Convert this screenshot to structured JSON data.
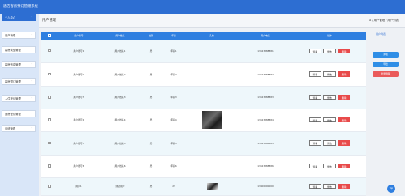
{
  "app": {
    "title": "酒店客房预订管理系统"
  },
  "sidebar": {
    "items": [
      {
        "label": "个人中心",
        "active": true
      },
      {
        "label": "用户管理",
        "active": false
      },
      {
        "label": "客房类型管理",
        "active": false
      },
      {
        "label": "客房信息管理",
        "active": false
      },
      {
        "label": "客房预订管理",
        "active": false
      },
      {
        "label": "入住登记管理",
        "active": false
      },
      {
        "label": "退房登记管理",
        "active": false
      },
      {
        "label": "系统管理",
        "active": false
      }
    ]
  },
  "header": {
    "page_title": "用户管理",
    "breadcrumb": "⌂ / 用户管理 / 用户列表"
  },
  "table": {
    "columns": [
      "",
      "用户账号",
      "用户姓名",
      "性别",
      "年龄",
      "头像",
      "用户电话",
      "操作"
    ],
    "rows": [
      {
        "account": "用户账号1",
        "name": "用户姓名1",
        "gender": "男",
        "age": "年龄1",
        "avatar": "",
        "phone": "13823888881"
      },
      {
        "account": "用户账号2",
        "name": "用户姓名2",
        "gender": "男",
        "age": "年龄2",
        "avatar": "",
        "phone": "13823888882"
      },
      {
        "account": "用户账号3",
        "name": "用户姓名3",
        "gender": "男",
        "age": "年龄3",
        "avatar": "",
        "phone": "13823888883"
      },
      {
        "account": "用户账号4",
        "name": "用户姓名4",
        "gender": "男",
        "age": "年龄4",
        "avatar": "photo",
        "phone": "13823888884"
      },
      {
        "account": "用户账号5",
        "name": "用户姓名5",
        "gender": "男",
        "age": "年龄5",
        "avatar": "",
        "phone": "13823888885"
      },
      {
        "account": "用户账号6",
        "name": "用户姓名6",
        "gender": "男",
        "age": "年龄6",
        "avatar": "",
        "phone": "13823888886"
      },
      {
        "account": "用户1",
        "name": "测试用户",
        "gender": "男",
        "age": "22",
        "avatar": "photo-small",
        "phone": "13800000000"
      }
    ],
    "actions": {
      "view": "查看",
      "edit": "修改",
      "delete": "删除"
    }
  },
  "right_panel": {
    "label": "用户列表",
    "buttons": [
      {
        "label": "添加",
        "color": "#2f8ee6"
      },
      {
        "label": "导出",
        "color": "#2f8ee6"
      },
      {
        "label": "批量删除",
        "color": "#ea5a5a"
      }
    ]
  },
  "top_button": {
    "label": "Top"
  },
  "colors": {
    "primary": "#2d6ed2",
    "header": "#2f7fe0",
    "danger": "#e84a4a"
  }
}
